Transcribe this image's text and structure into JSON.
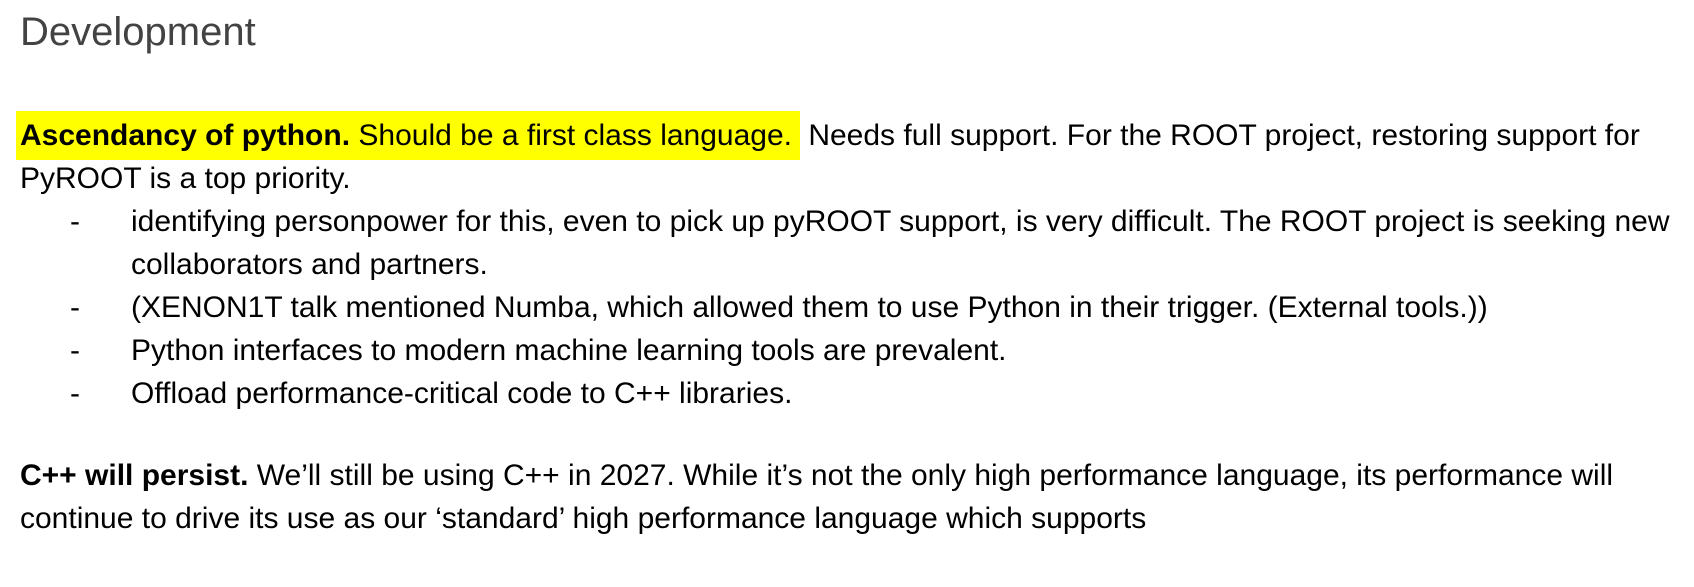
{
  "heading": "Development",
  "para1": {
    "bold_lead": "Ascendancy of python.",
    "highlighted_rest": " Should be a first class language.",
    "text": " Needs full support. For the ROOT project, restoring support for PyROOT is a top priority."
  },
  "bullet_marker": "-",
  "bullets": [
    "identifying personpower for this, even to pick up pyROOT support, is very difficult. The ROOT project is seeking new collaborators and partners.",
    "(XENON1T talk mentioned Numba, which allowed them to use Python in their trigger. (External tools.))",
    "Python interfaces to modern machine learning tools are prevalent.",
    "Offload performance-critical code to C++ libraries."
  ],
  "para2": {
    "bold_lead": "C++ will persist.",
    "text": " We’ll still be using C++ in 2027. While it’s not the only high performance language, its performance will continue to drive its use as our ‘standard’ high performance language which supports"
  },
  "colors": {
    "highlight": "#ffff00",
    "heading": "#434343",
    "text": "#000000"
  }
}
